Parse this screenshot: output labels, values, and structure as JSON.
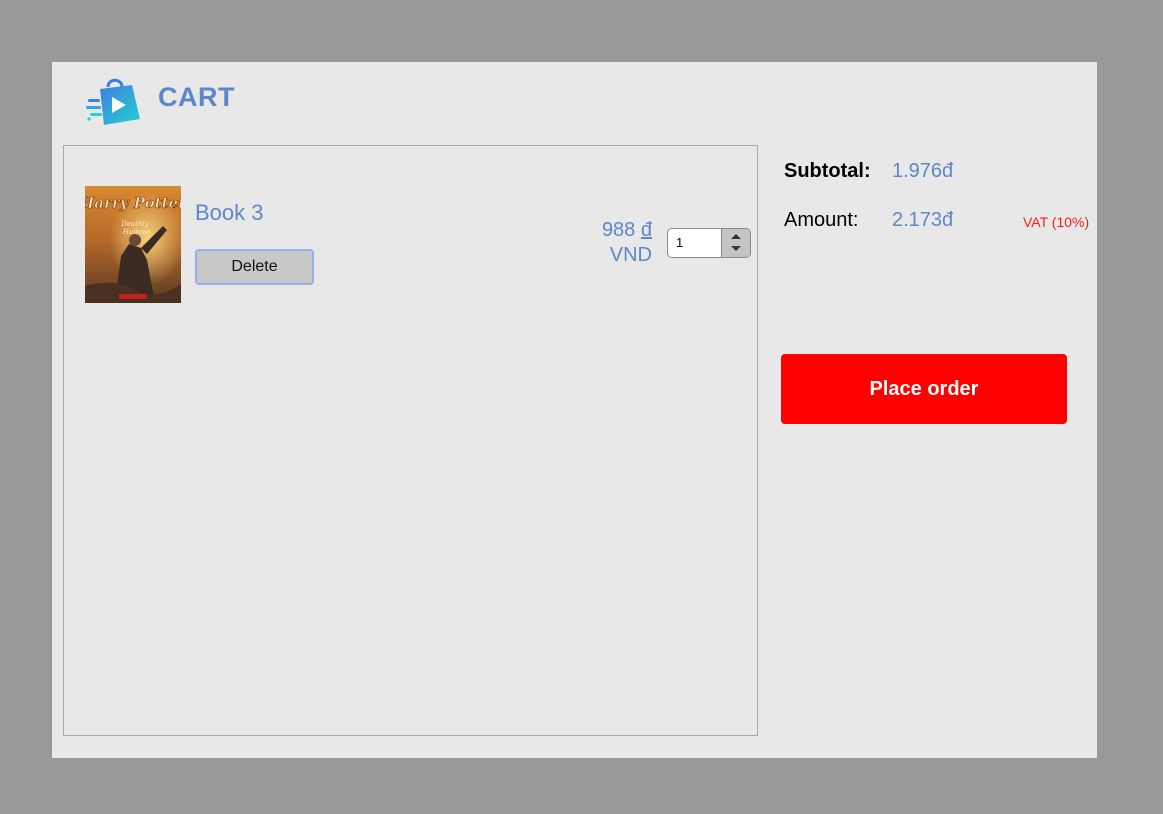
{
  "header": {
    "title": "CART",
    "logo_icon": "shopping-bag-logo-icon"
  },
  "cart": {
    "items": [
      {
        "title": "Book 3",
        "cover_icon": "book-cover-image",
        "cover_lettering": "Harry Potter",
        "price_amount": "988 ",
        "price_symbol": "đ",
        "price_unit": "VND",
        "quantity": "1",
        "delete_label": "Delete"
      }
    ]
  },
  "summary": {
    "subtotal_label": "Subtotal:",
    "subtotal_value": "1.976đ",
    "amount_label": "Amount:",
    "amount_value": "2.173đ",
    "vat_note": "VAT (10%)",
    "place_order_label": "Place order"
  },
  "colors": {
    "accent_blue": "#5e86c9",
    "danger_red": "#ff0000",
    "page_background": "#e8e8e8",
    "outer_background": "#999999"
  }
}
